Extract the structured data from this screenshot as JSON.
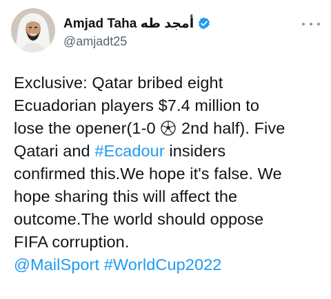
{
  "author": {
    "display_name": "Amjad Taha أمجد طه",
    "handle": "@amjadt25",
    "verified": true,
    "avatar": "profile-photo"
  },
  "icons": {
    "verified": "verified-badge-icon",
    "more": "more-options-icon",
    "ball": "soccer-ball-icon"
  },
  "colors": {
    "text": "#0f1419",
    "secondary": "#536471",
    "link": "#1d9bf0"
  },
  "tweet": {
    "line1": "Exclusive: Qatar bribed eight",
    "line2": "Ecuadorian players $7.4 million to",
    "line3_before": "lose the opener(1-0",
    "line3_after": "2nd half). Five",
    "line4_before": "Qatari and",
    "hashtag_ecadour": "#Ecadour",
    "line4_after": "insiders",
    "line5": "confirmed this.We hope it's false. We",
    "line6": "hope sharing this will affect the",
    "line7": "outcome.The world should oppose",
    "line8": "FIFA corruption.",
    "mention_mailsport": "@MailSport",
    "hashtag_worldcup": "#WorldCup2022"
  }
}
